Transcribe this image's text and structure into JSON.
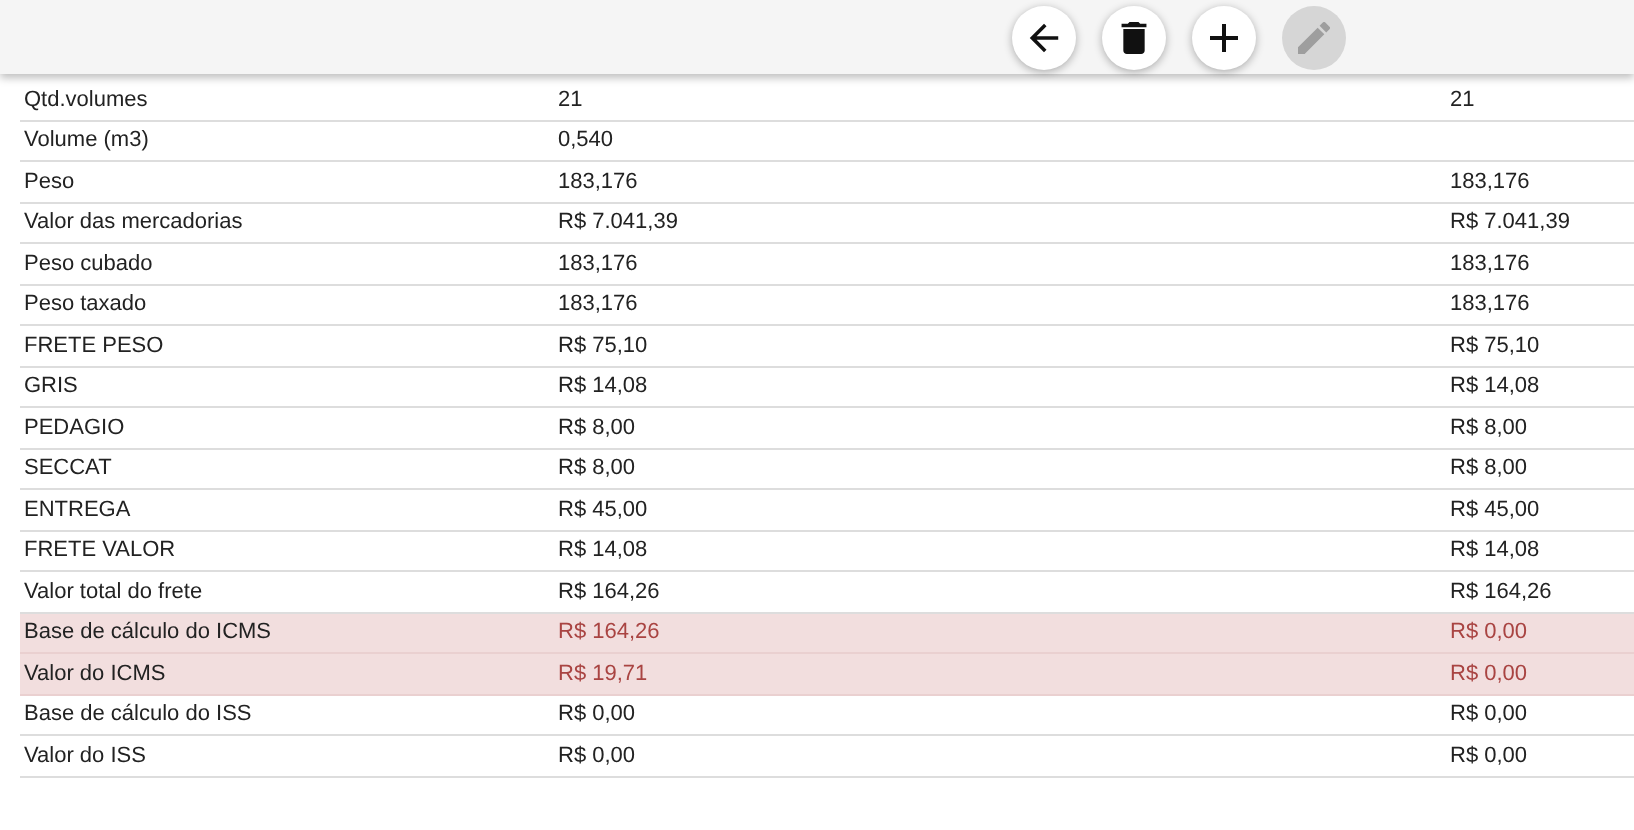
{
  "toolbar": {
    "buttons": [
      {
        "kind": "back",
        "disabled": false
      },
      {
        "kind": "delete",
        "disabled": false
      },
      {
        "kind": "add",
        "disabled": false
      },
      {
        "kind": "edit",
        "disabled": true
      }
    ]
  },
  "table": {
    "rows": [
      {
        "label": "Qtd.volumes",
        "value": "21",
        "column_3": "21",
        "highlighted": false
      },
      {
        "label": "Volume (m3)",
        "value": "0,540",
        "column_3": "",
        "highlighted": false
      },
      {
        "label": "Peso",
        "value": "183,176",
        "column_3": "183,176",
        "highlighted": false
      },
      {
        "label": "Valor das mercadorias",
        "value": "R$ 7.041,39",
        "column_3": "R$ 7.041,39",
        "highlighted": false
      },
      {
        "label": "Peso cubado",
        "value": "183,176",
        "column_3": "183,176",
        "highlighted": false
      },
      {
        "label": "Peso taxado",
        "value": "183,176",
        "column_3": "183,176",
        "highlighted": false
      },
      {
        "label": "FRETE PESO",
        "value": "R$ 75,10",
        "column_3": "R$ 75,10",
        "highlighted": false
      },
      {
        "label": "GRIS",
        "value": "R$ 14,08",
        "column_3": "R$ 14,08",
        "highlighted": false
      },
      {
        "label": "PEDAGIO",
        "value": "R$ 8,00",
        "column_3": "R$ 8,00",
        "highlighted": false
      },
      {
        "label": "SECCAT",
        "value": "R$ 8,00",
        "column_3": "R$ 8,00",
        "highlighted": false
      },
      {
        "label": "ENTREGA",
        "value": "R$ 45,00",
        "column_3": "R$ 45,00",
        "highlighted": false
      },
      {
        "label": "FRETE VALOR",
        "value": "R$ 14,08",
        "column_3": "R$ 14,08",
        "highlighted": false
      },
      {
        "label": "Valor total do frete",
        "value": "R$ 164,26",
        "column_3": "R$ 164,26",
        "highlighted": false
      },
      {
        "label": "Base de cálculo do ICMS",
        "value": "R$ 164,26",
        "column_3": "R$ 0,00",
        "highlighted": true
      },
      {
        "label": "Valor do ICMS",
        "value": "R$ 19,71",
        "column_3": "R$ 0,00",
        "highlighted": true
      },
      {
        "label": "Base de cálculo do ISS",
        "value": "R$ 0,00",
        "column_3": "R$ 0,00",
        "highlighted": false
      },
      {
        "label": "Valor do ISS",
        "value": "R$ 0,00",
        "column_3": "R$ 0,00",
        "highlighted": false
      }
    ]
  }
}
